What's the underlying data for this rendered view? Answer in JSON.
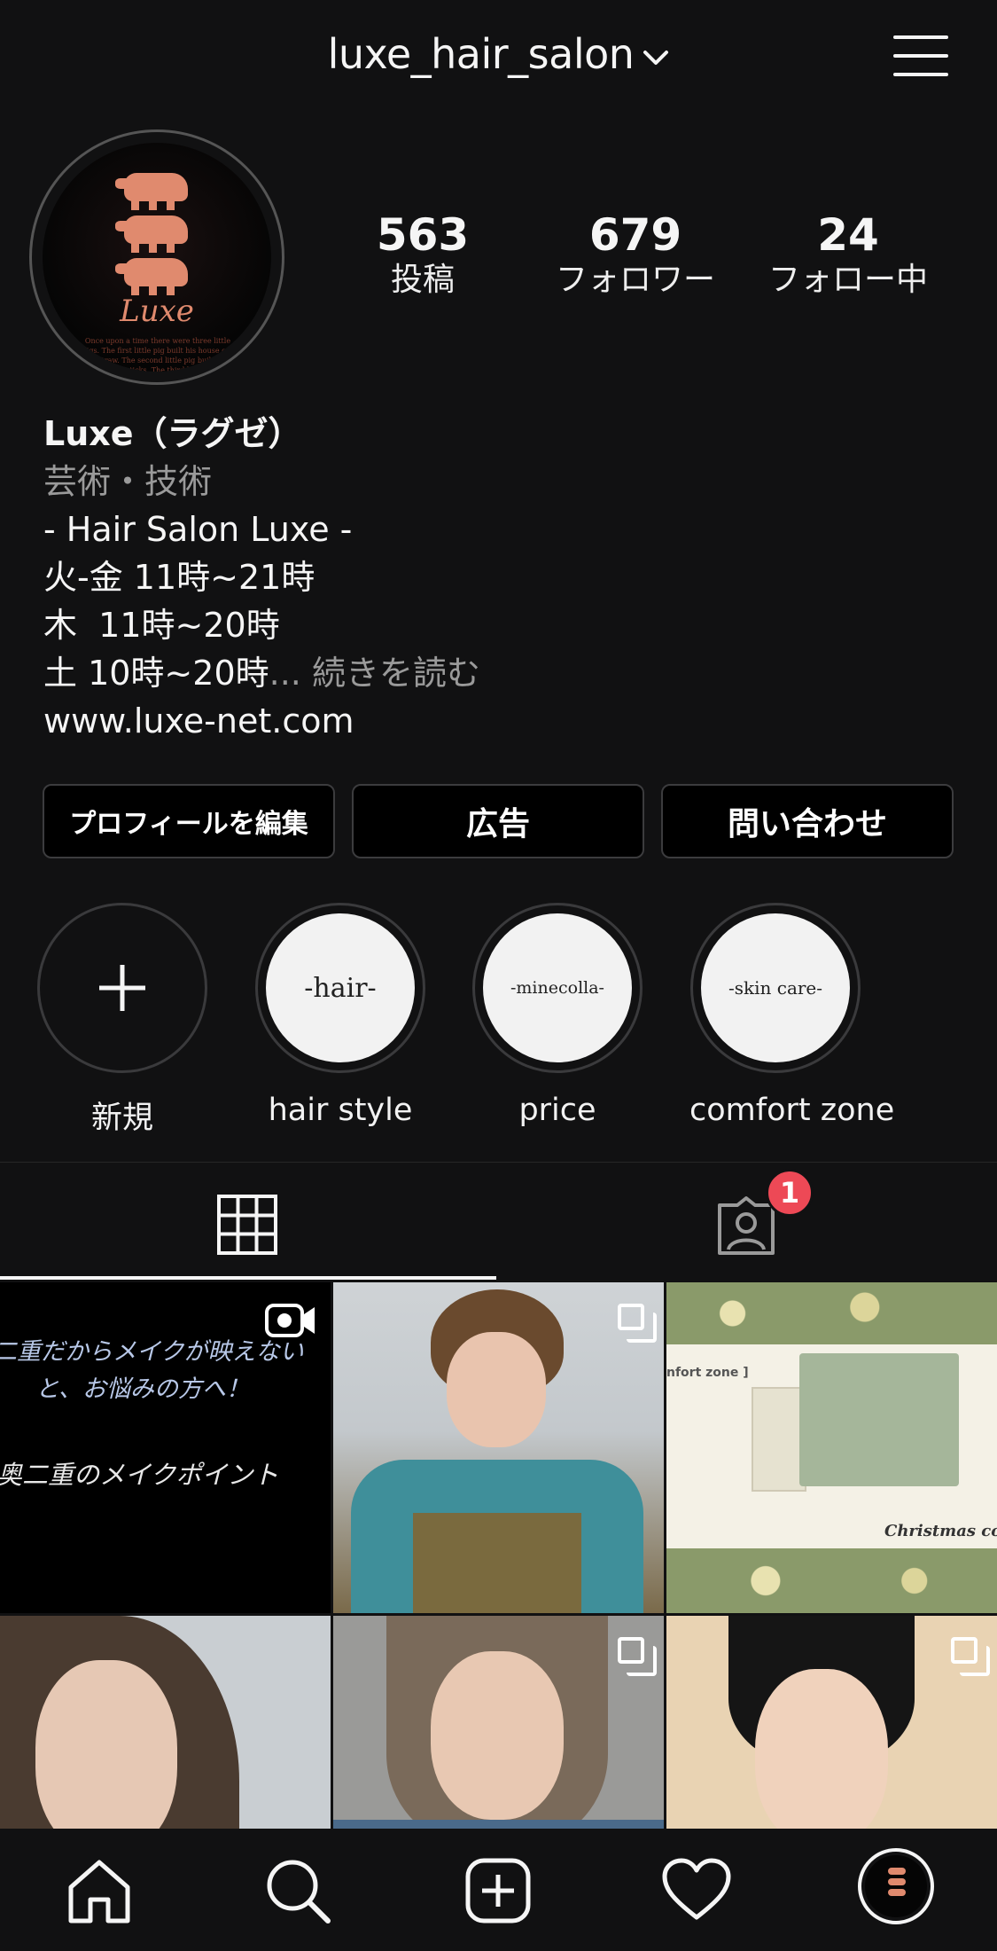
{
  "header": {
    "username": "luxe_hair_salon"
  },
  "avatar": {
    "logo_text": "Luxe",
    "small_print": "Once upon a time there were three little pigs. The first little pig built his house out of straw. The second little pig built his house out of sticks. The third little pig built his house out of bricks."
  },
  "stats": {
    "posts": {
      "value": "563",
      "label": "投稿"
    },
    "followers": {
      "value": "679",
      "label": "フォロワー"
    },
    "following": {
      "value": "24",
      "label": "フォロー中"
    }
  },
  "bio": {
    "name": "Luxe（ラグゼ）",
    "category": "芸術・技術",
    "lines": [
      "- Hair Salon Luxe -",
      "火-金 11時~21時",
      "木  11時~20時",
      "土 10時~20時"
    ],
    "more": "... 続きを読む",
    "website": "www.luxe-net.com"
  },
  "buttons": {
    "edit_profile": "プロフィールを編集",
    "ads": "広告",
    "contact": "問い合わせ"
  },
  "highlights": [
    {
      "cover": "",
      "caption": "新規"
    },
    {
      "cover": "-hair-",
      "caption": "hair style"
    },
    {
      "cover": "-minecolla-",
      "caption": "price"
    },
    {
      "cover": "-skin care-",
      "caption": "comfort zone"
    }
  ],
  "tabs": {
    "grid_icon": "grid-icon",
    "tagged_icon": "tagged-person-icon",
    "tagged_badge": "1"
  },
  "posts": [
    {
      "type": "video",
      "text_line1": "二重だからメイクが映えない",
      "text_line2": "と、お悩みの方へ！",
      "text_line3": "奥二重のメイクポイント"
    },
    {
      "type": "carousel"
    },
    {
      "type": "image",
      "overlay_top": "nfort zone ]",
      "overlay_bottom": "Christmas co"
    },
    {
      "type": "image"
    },
    {
      "type": "carousel"
    },
    {
      "type": "carousel"
    }
  ],
  "bottom_nav": [
    "home-icon",
    "search-icon",
    "new-post-icon",
    "activity-heart-icon",
    "profile-avatar-icon"
  ],
  "colors": {
    "background": "#111112",
    "badge": "#ed4956",
    "logo_accent": "#e08a6e"
  }
}
